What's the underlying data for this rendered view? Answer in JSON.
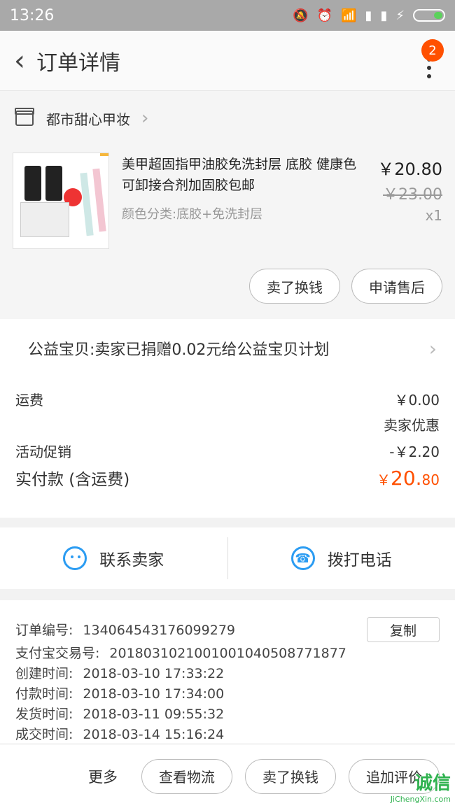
{
  "status": {
    "time": "13:26"
  },
  "header": {
    "title": "订单详情",
    "badge": "2"
  },
  "shop": {
    "name": "都市甜心甲妆"
  },
  "product": {
    "title": "美甲超固指甲油胶免洗封层 底胶 健康色 可卸接合剂加固胶包邮",
    "spec": "颜色分类:底胶+免洗封层",
    "price": "￥20.80",
    "original_price": "￥23.00",
    "quantity": "x1",
    "actions": [
      "卖了换钱",
      "申请售后"
    ]
  },
  "charity": {
    "text": "公益宝贝:卖家已捐赠0.02元给公益宝贝计划"
  },
  "fees": {
    "shipping_label": "运费",
    "shipping_value": "￥0.00",
    "seller_discount": "卖家优惠",
    "promo_label": "活动促销",
    "promo_value": "-￥2.20",
    "paid_label": "实付款 (含运费)",
    "paid_currency": "￥",
    "paid_integer": "20.",
    "paid_decimal": "80"
  },
  "contact": {
    "seller": "联系卖家",
    "call": "拨打电话"
  },
  "order_info": {
    "copy_label": "复制",
    "rows": [
      {
        "label": "订单编号:",
        "value": "134064543176099279"
      },
      {
        "label": "支付宝交易号:",
        "value": "2018031021001001040508771877"
      },
      {
        "label": "创建时间:",
        "value": "2018-03-10 17:33:22"
      },
      {
        "label": "付款时间:",
        "value": "2018-03-10 17:34:00"
      },
      {
        "label": "发货时间:",
        "value": "2018-03-11 09:55:32"
      },
      {
        "label": "成交时间:",
        "value": "2018-03-14 15:16:24"
      }
    ]
  },
  "bottom": {
    "more": "更多",
    "buttons": [
      "查看物流",
      "卖了换钱",
      "追加评价"
    ]
  },
  "watermark": {
    "main": "诚信",
    "sub": "JiChengXin.com"
  },
  "colors": {
    "accent": "#ff5000",
    "contact": "#2b9cf2"
  }
}
